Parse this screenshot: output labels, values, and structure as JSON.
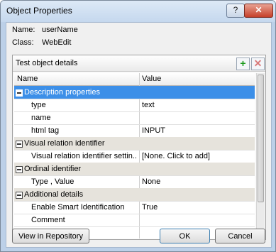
{
  "window": {
    "title": "Object Properties",
    "help_glyph": "?",
    "close_glyph": "✕"
  },
  "info": {
    "name_label": "Name:",
    "name_value": "userName",
    "class_label": "Class:",
    "class_value": "WebEdit"
  },
  "group": {
    "title": "Test object details",
    "add_glyph": "+",
    "remove_glyph": "✕"
  },
  "grid": {
    "columns": [
      "Name",
      "Value"
    ],
    "rows": [
      {
        "kind": "category",
        "name": "Description properties",
        "value": "",
        "selected": true
      },
      {
        "kind": "prop",
        "name": "type",
        "value": "text"
      },
      {
        "kind": "prop",
        "name": "name",
        "value": ""
      },
      {
        "kind": "prop",
        "name": "html tag",
        "value": "INPUT"
      },
      {
        "kind": "category",
        "name": "Visual relation identifier",
        "value": ""
      },
      {
        "kind": "prop",
        "name": "Visual relation identifier settin...",
        "value": "[None. Click to add]"
      },
      {
        "kind": "category",
        "name": "Ordinal identifier",
        "value": ""
      },
      {
        "kind": "prop",
        "name": "Type , Value",
        "value": "None"
      },
      {
        "kind": "category",
        "name": "Additional details",
        "value": ""
      },
      {
        "kind": "prop",
        "name": "Enable Smart Identification",
        "value": "True"
      },
      {
        "kind": "prop",
        "name": "Comment",
        "value": ""
      }
    ]
  },
  "buttons": {
    "repository": "View in Repository",
    "ok": "OK",
    "cancel": "Cancel"
  },
  "colors": {
    "selection": "#3c8fe8",
    "category_bg": "#e6e3dc",
    "add_icon": "#1a9a1a",
    "remove_icon": "#d97a7a"
  }
}
